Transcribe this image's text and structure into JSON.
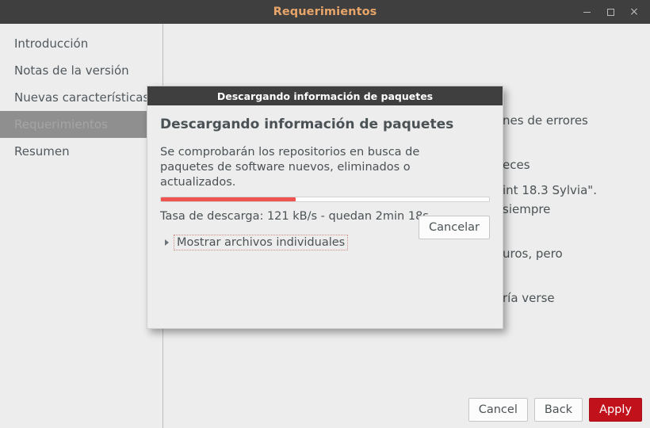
{
  "window": {
    "title": "Requerimientos",
    "controls": {
      "minimize": "minimize-icon",
      "maximize": "maximize-icon",
      "close": "×"
    }
  },
  "sidebar": {
    "items": [
      {
        "label": "Introducción",
        "selected": false
      },
      {
        "label": "Notas de la versión",
        "selected": false
      },
      {
        "label": "Nuevas características",
        "selected": false
      },
      {
        "label": "Requerimientos",
        "selected": true
      },
      {
        "label": "Resumen",
        "selected": false
      }
    ]
  },
  "content": {
    "background_lines": [
      "nes de errores",
      "eces",
      "siempre",
      "uros, pero",
      "ría verse"
    ],
    "background_line_bottom": "int 18.3 Sylvia\"."
  },
  "actions": {
    "cancel": "Cancel",
    "back": "Back",
    "apply": "Apply"
  },
  "dialog": {
    "titlebar_title": "Descargando información de paquetes",
    "heading": "Descargando información de paquetes",
    "description": "Se comprobarán los repositorios en busca de paquetes de software nuevos, eliminados o actualizados.",
    "progress": {
      "percent": 41,
      "fill_color": "#ef5350"
    },
    "rate_text": "Tasa de descarga: 121 kB/s - quedan 2min 18s",
    "expander_label": "Mostrar archivos individuales",
    "cancel_button": "Cancelar"
  },
  "colors": {
    "titlebar_bg": "#3f3f3f",
    "titlebar_text": "#e8a56a",
    "window_bg": "#ededed",
    "selection_bg": "#8f8f8f",
    "accent_red": "#ef5350",
    "apply_red": "#c1121c"
  }
}
